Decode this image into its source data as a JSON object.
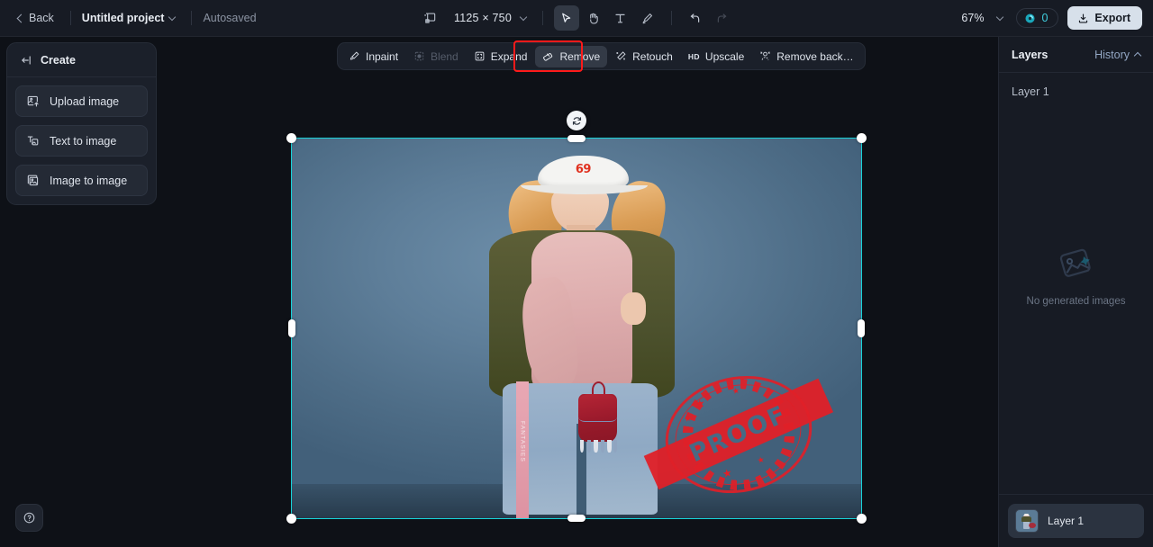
{
  "topbar": {
    "back_label": "Back",
    "project_name": "Untitled project",
    "autosave_status": "Autosaved",
    "canvas_size": "1125 × 750",
    "canvas_size_icon": "frame-size-icon",
    "tools": [
      {
        "name": "select-tool",
        "icon": "cursor-arrow-icon",
        "state": "active"
      },
      {
        "name": "pan-tool",
        "icon": "hand-icon",
        "state": "default"
      },
      {
        "name": "text-tool",
        "icon": "text-t-icon",
        "state": "default"
      },
      {
        "name": "brush-tool",
        "icon": "brush-icon",
        "state": "default"
      }
    ],
    "undo_icon": "undo-arrow-icon",
    "redo_icon": "redo-arrow-icon",
    "undo_state": "enabled",
    "redo_state": "disabled",
    "zoom_level": "67%",
    "credits_count": "0",
    "credits_icon": "credit-coin-icon",
    "export_label": "Export",
    "export_icon": "download-icon"
  },
  "create_panel": {
    "title": "Create",
    "collapse_icon": "collapse-left-icon",
    "items": [
      {
        "label": "Upload image",
        "icon": "upload-image-icon"
      },
      {
        "label": "Text to image",
        "icon": "text-to-image-icon"
      },
      {
        "label": "Image to image",
        "icon": "image-to-image-icon"
      }
    ]
  },
  "help": {
    "icon": "question-mark-icon"
  },
  "edit_toolbar": {
    "buttons": [
      {
        "label": "Inpaint",
        "icon": "inpaint-brush-icon",
        "state": "default"
      },
      {
        "label": "Blend",
        "icon": "blend-icon",
        "state": "disabled"
      },
      {
        "label": "Expand",
        "icon": "expand-frame-icon",
        "state": "default"
      },
      {
        "label": "Remove",
        "icon": "eraser-icon",
        "state": "active",
        "highlighted": true
      },
      {
        "label": "Retouch",
        "icon": "retouch-sparkle-icon",
        "state": "default"
      },
      {
        "label": "Upscale",
        "icon": "hd-badge-icon",
        "badge": "HD",
        "state": "default"
      },
      {
        "label": "Remove back…",
        "icon": "remove-background-icon",
        "state": "default"
      }
    ],
    "highlight_color": "#ff1a1a"
  },
  "canvas": {
    "selection_color": "#19d3d9",
    "rotate_icon": "rotate-refresh-icon",
    "backdrop_color": "#5b7b96",
    "photo": {
      "cap_number": "69",
      "jeans_stripe_text": "FANTASIES",
      "watermark_text": "PROOF",
      "watermark_color": "#e02028"
    }
  },
  "layers_panel": {
    "tab_layers": "Layers",
    "tab_history": "History",
    "history_chevron_icon": "chevron-up-icon",
    "section_label": "Layer 1",
    "empty_state_text": "No generated images",
    "empty_state_icon": "image-placeholder-icon",
    "layer_rows": [
      {
        "name": "Layer 1",
        "thumbnail": "canvas-thumbnail"
      }
    ]
  }
}
